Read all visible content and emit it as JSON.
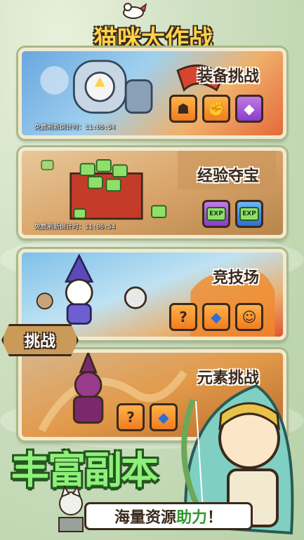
{
  "title": "猫咪大作战",
  "cards": [
    {
      "title": "装备挑战",
      "timer": "免费刷新倒计时：11:06:54",
      "rewards": [
        {
          "icon": "gold-armor-icon",
          "glyph": "☗",
          "color": "orange"
        },
        {
          "icon": "gold-glove-icon",
          "glyph": "✊",
          "color": "orange"
        },
        {
          "icon": "purple-gem-icon",
          "glyph": "◆",
          "color": "purple"
        }
      ]
    },
    {
      "title": "经验夺宝",
      "timer": "免费刷新倒计时：11:06:54",
      "rewards": [
        {
          "icon": "exp-crystal-purple-icon",
          "label": "EXP",
          "color": "purple"
        },
        {
          "icon": "exp-crystal-blue-icon",
          "label": "EXP",
          "color": "blue"
        }
      ]
    },
    {
      "title": "竞技场",
      "rewards": [
        {
          "icon": "mystery-chest-icon",
          "glyph": "?",
          "color": "orange"
        },
        {
          "icon": "blue-diamond-icon",
          "glyph": "◆",
          "color": "orange"
        },
        {
          "icon": "cat-coin-icon",
          "glyph": "☺",
          "color": "orange"
        }
      ]
    },
    {
      "title": "元素挑战",
      "rewards": [
        {
          "icon": "mystery-chest-icon",
          "glyph": "?",
          "color": "orange"
        },
        {
          "icon": "blue-diamond-icon",
          "glyph": "◆",
          "color": "orange"
        }
      ]
    }
  ],
  "challenge_button": "挑战",
  "slogan": "丰富副本",
  "banner": {
    "text": "海量资源",
    "highlight": "助力",
    "suffix": "！"
  }
}
